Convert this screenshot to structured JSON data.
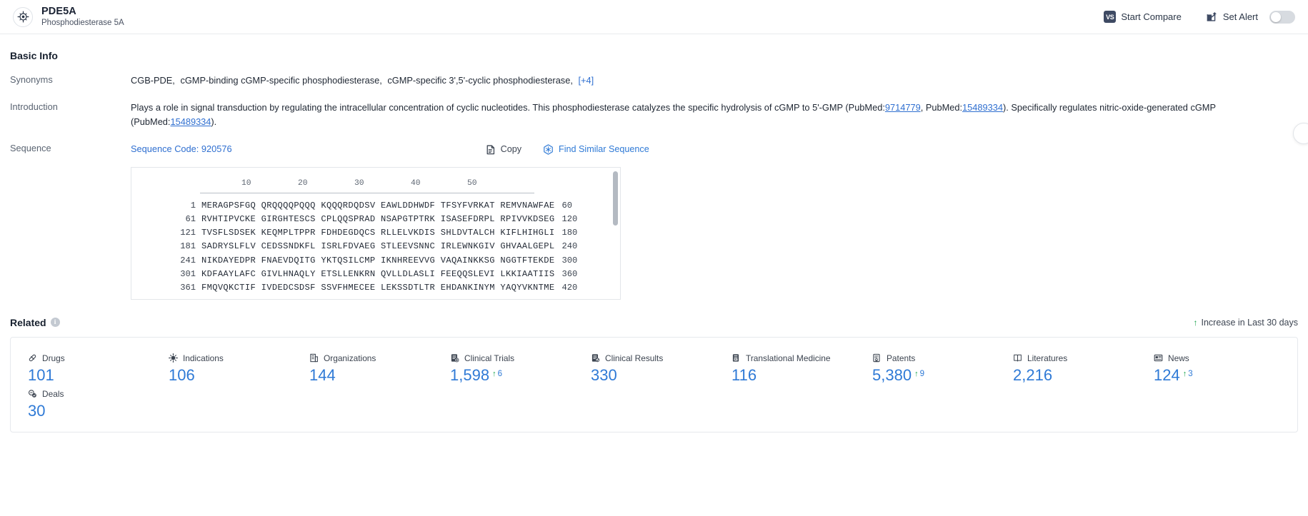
{
  "header": {
    "logo_icon": "target-protein-icon",
    "title": "PDE5A",
    "subtitle": "Phosphodiesterase 5A",
    "compare_label": "Start Compare",
    "compare_badge": "VS",
    "alert_label": "Set Alert",
    "alert_icon": "mail-alert-icon",
    "alert_toggle_state": "off"
  },
  "basic_info": {
    "section_title": "Basic Info",
    "synonyms": {
      "label": "Synonyms",
      "items": [
        "CGB-PDE,",
        "cGMP-binding cGMP-specific phosphodiesterase,",
        "cGMP-specific 3',5'-cyclic phosphodiesterase,"
      ],
      "more_label": "[+4]"
    },
    "introduction": {
      "label": "Introduction",
      "text_1": "Plays a role in signal transduction by regulating the intracellular concentration of cyclic nucleotides. This phosphodiesterase catalyzes the specific hydrolysis of cGMP to 5'-GMP (PubMed:",
      "pubmed_1": "9714779",
      "text_2": ", PubMed:",
      "pubmed_2": "15489334",
      "text_3": "). Specifically regulates nitric-oxide-generated cGMP (PubMed:",
      "pubmed_3": "15489334",
      "text_4": ")."
    },
    "sequence": {
      "label": "Sequence",
      "code_label": "Sequence Code: 920576",
      "copy_label": "Copy",
      "copy_icon": "copy-icon",
      "find_label": "Find Similar Sequence",
      "find_icon": "molecule-search-icon",
      "ruler_ticks": [
        "10",
        "20",
        "30",
        "40",
        "50"
      ],
      "lines": [
        {
          "start": "1",
          "residues": "MERAGPSFGQ QRQQQQPQQQ KQQQRDQDSV EAWLDDHWDF TFSYFVRKAT REMVNAWFAE",
          "end": "60"
        },
        {
          "start": "61",
          "residues": "RVHTIPVCKE GIRGHTESCS CPLQQSPRAD NSAPGTPTRK ISASEFDRPL RPIVVKDSEG",
          "end": "120"
        },
        {
          "start": "121",
          "residues": "TVSFLSDSEK KEQMPLTPPR FDHDEGDQCS RLLELVKDIS SHLDVTALCH KIFLHIHGLI",
          "end": "180"
        },
        {
          "start": "181",
          "residues": "SADRYSLFLV CEDSSNDKFL ISRLFDVAEG STLEEVSNNC IRLEWNKGIV GHVAALGEPL",
          "end": "240"
        },
        {
          "start": "241",
          "residues": "NIKDAYEDPR FNAEVDQITG YKTQSILCMP IKNHREEVVG VAQAINKKSG NGGTFTEKDE",
          "end": "300"
        },
        {
          "start": "301",
          "residues": "KDFAAYLAFC GIVLHNAQLY ETSLLENKRN QVLLDLASLI FEEQQSLEVI LKKIAATIIS",
          "end": "360"
        },
        {
          "start": "361",
          "residues": "FMQVQKCTIF IVDEDCSDSF SSVFHMECEE LEKSSDTLTR EHDANKINYM YAQYVKNTME",
          "end": "420"
        }
      ]
    }
  },
  "related": {
    "section_title": "Related",
    "trend_label": "Increase in Last 30 days",
    "trend_arrow": "↑",
    "items": [
      {
        "icon": "pill-icon",
        "label": "Drugs",
        "value": "101",
        "delta": ""
      },
      {
        "icon": "virus-icon",
        "label": "Indications",
        "value": "106",
        "delta": ""
      },
      {
        "icon": "building-icon",
        "label": "Organizations",
        "value": "144",
        "delta": ""
      },
      {
        "icon": "clinical-trial-icon",
        "label": "Clinical Trials",
        "value": "1,598",
        "delta": "6"
      },
      {
        "icon": "clinical-result-icon",
        "label": "Clinical Results",
        "value": "330",
        "delta": ""
      },
      {
        "icon": "translational-icon",
        "label": "Translational Medicine",
        "value": "116",
        "delta": ""
      },
      {
        "icon": "patent-icon",
        "label": "Patents",
        "value": "5,380",
        "delta": "9"
      },
      {
        "icon": "literature-icon",
        "label": "Literatures",
        "value": "2,216",
        "delta": ""
      },
      {
        "icon": "news-icon",
        "label": "News",
        "value": "124",
        "delta": "3"
      },
      {
        "icon": "deal-icon",
        "label": "Deals",
        "value": "30",
        "delta": ""
      }
    ]
  }
}
